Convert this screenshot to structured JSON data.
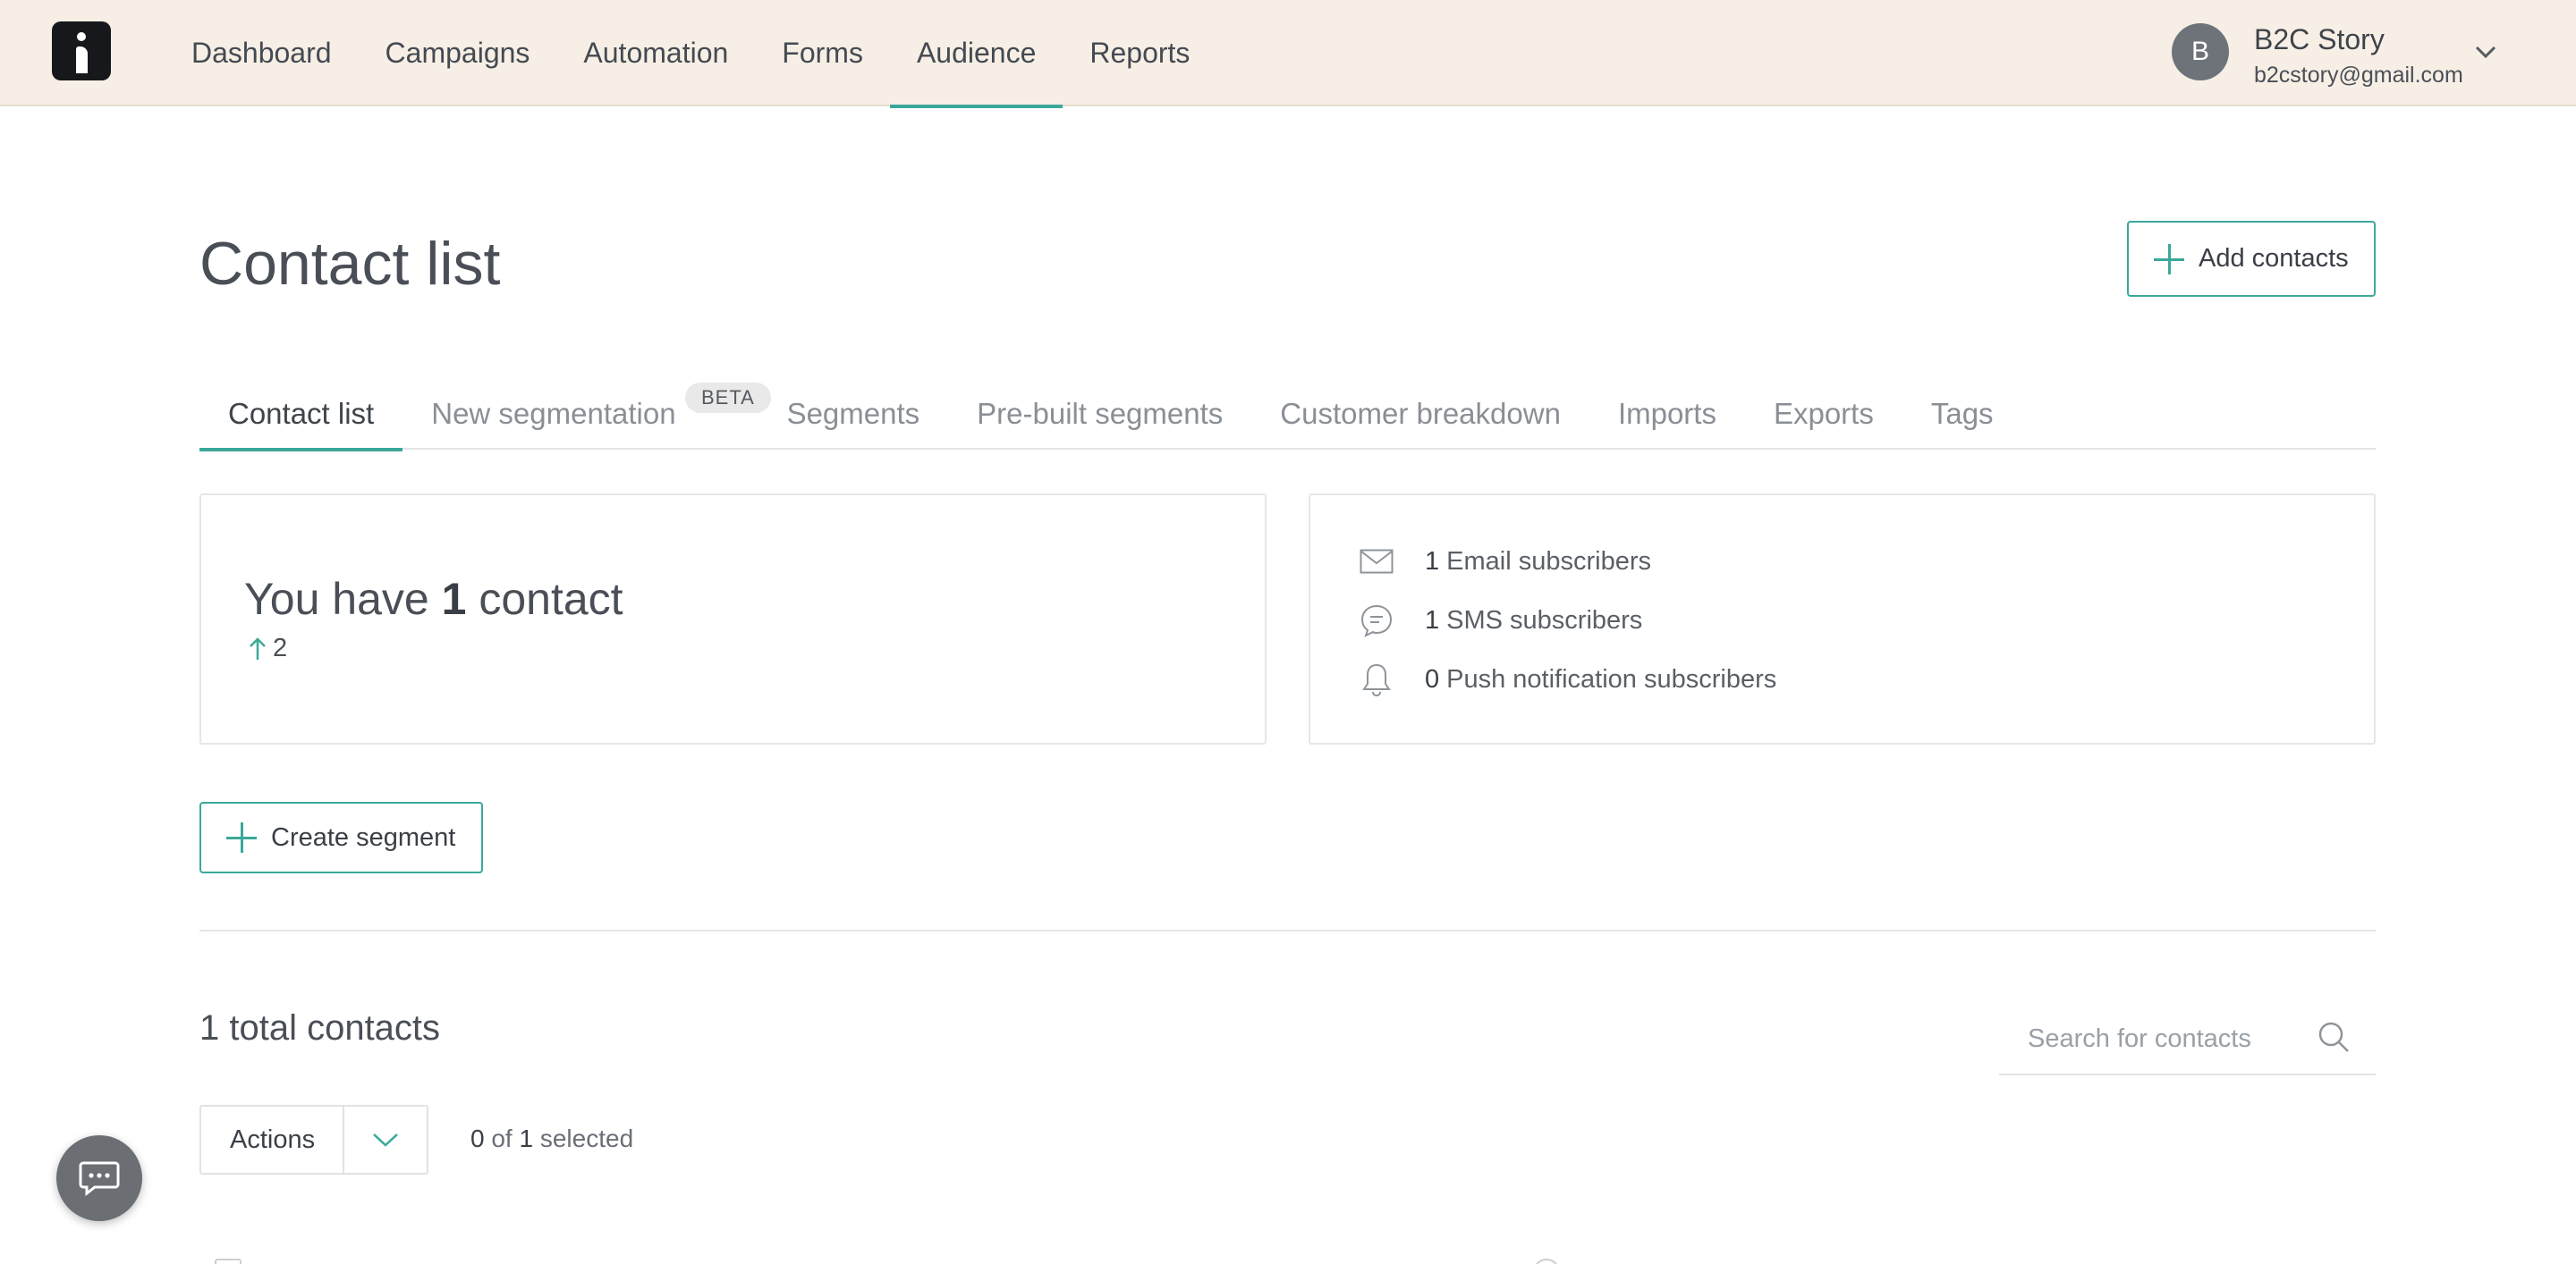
{
  "nav": {
    "items": [
      {
        "label": "Dashboard",
        "active": false
      },
      {
        "label": "Campaigns",
        "active": false
      },
      {
        "label": "Automation",
        "active": false
      },
      {
        "label": "Forms",
        "active": false
      },
      {
        "label": "Audience",
        "active": true
      },
      {
        "label": "Reports",
        "active": false
      }
    ]
  },
  "user": {
    "initial": "B",
    "name": "B2C Story",
    "email": "b2cstory@gmail.com"
  },
  "page": {
    "title": "Contact list",
    "add_contacts_label": "Add contacts"
  },
  "tabs": [
    {
      "label": "Contact list",
      "active": true
    },
    {
      "label": "New segmentation",
      "active": false
    },
    {
      "label": "Segments",
      "active": false
    },
    {
      "label": "Pre-built segments",
      "active": false
    },
    {
      "label": "Customer breakdown",
      "active": false
    },
    {
      "label": "Imports",
      "active": false
    },
    {
      "label": "Exports",
      "active": false
    },
    {
      "label": "Tags",
      "active": false
    }
  ],
  "beta_badge": "BETA",
  "summary": {
    "prefix": "You have",
    "count": "1",
    "suffix": "contact",
    "trend_value": "2"
  },
  "subscribers": [
    {
      "icon": "envelope-icon",
      "count": "1",
      "label": "Email subscribers"
    },
    {
      "icon": "chat-bubble-icon",
      "count": "1",
      "label": "SMS subscribers"
    },
    {
      "icon": "bell-icon",
      "count": "0",
      "label": "Push notification subscribers"
    }
  ],
  "create_segment_label": "Create segment",
  "contacts": {
    "total_label": "1 total contacts",
    "search_placeholder": "Search for contacts",
    "actions_label": "Actions",
    "selected_count": "0",
    "selected_of": "of",
    "selected_total": "1",
    "selected_suffix": "selected"
  },
  "colors": {
    "accent": "#3aa89a",
    "topbar_bg": "#f7efe5",
    "avatar_bg": "#6e737a",
    "chat_bg": "#6b6f74"
  }
}
